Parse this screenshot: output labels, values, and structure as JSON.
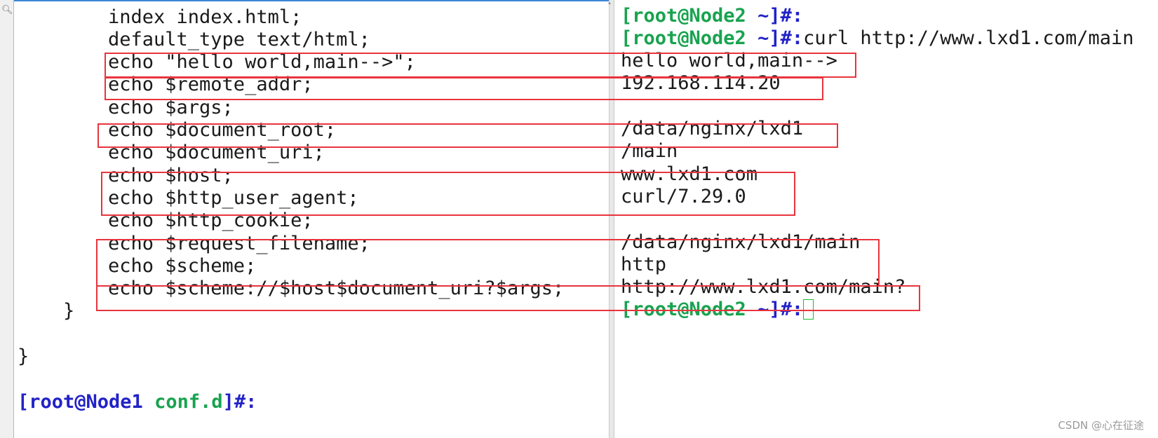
{
  "left_terminal": {
    "config_lines": [
      "index index.html;",
      "default_type text/html;",
      "echo \"hello world,main-->\";",
      "echo $remote_addr;",
      "echo $args;",
      "echo $document_root;",
      "echo $document_uri;",
      "echo $host;",
      "echo $http_user_agent;",
      "echo $http_cookie;",
      "echo $request_filename;",
      "echo $scheme;",
      "echo $scheme://$host$document_uri?$args;"
    ],
    "inner_close_brace": "}",
    "outer_close_brace": "}",
    "prompt": {
      "user_host": "[root@Node1",
      "dir": "conf.d",
      "suffix": "]#:"
    }
  },
  "right_terminal": {
    "prompt_green": "[root@Node2 ",
    "prompt_blue": "~]#:",
    "command": "curl http://www.lxd1.com/main",
    "output_lines": [
      "hello world,main-->",
      "192.168.114.20",
      "",
      "/data/nginx/lxd1",
      "/main",
      "www.lxd1.com",
      "curl/7.29.0",
      "",
      "/data/nginx/lxd1/main",
      "http",
      "http://www.lxd1.com/main?"
    ]
  },
  "watermark": "CSDN @心在征途",
  "colors": {
    "highlight_box": "#e8343d",
    "prompt_green": "#18a34f",
    "prompt_blue": "#2222c8",
    "cursor": "#18c030",
    "pane_border": "#3b86d6"
  },
  "icons": {
    "gutter": "magnifier-icon",
    "scrollbar": "scroll-up-icon"
  }
}
